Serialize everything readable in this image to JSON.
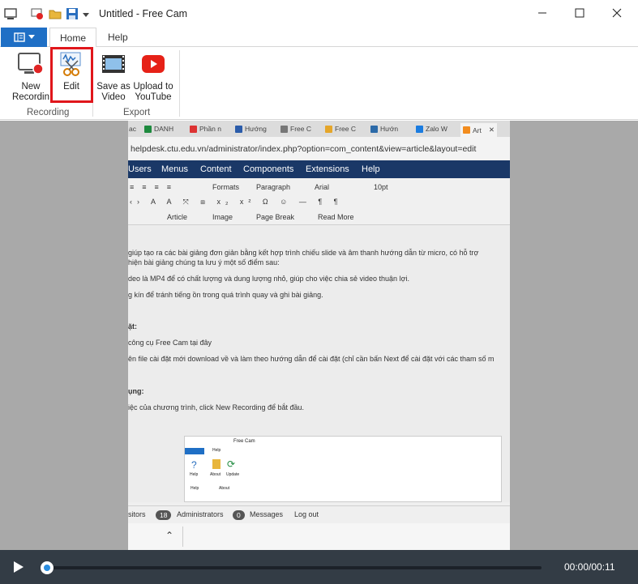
{
  "window": {
    "title": "Untitled - Free Cam"
  },
  "ribbon": {
    "tabs": [
      "Home",
      "Help"
    ],
    "buttons": {
      "new_recording": "New\nRecordin",
      "edit": "Edit",
      "save_as_video": "Save as\nVideo",
      "upload_youtube": "Upload to\nYouTube"
    },
    "groups": {
      "recording": "Recording",
      "export": "Export"
    }
  },
  "preview": {
    "browser_tabs": [
      "ac",
      "DANH",
      "Phần n",
      "Hướng",
      "Free C",
      "Free C",
      "Hướn",
      "Zalo W",
      "Art"
    ],
    "url": "helpdesk.ctu.edu.vn/administrator/index.php?option=com_content&view=article&layout=edit",
    "menu": [
      "Users",
      "Menus",
      "Content",
      "Components",
      "Extensions",
      "Help"
    ],
    "toolbar": {
      "formats": "Formats",
      "paragraph": "Paragraph",
      "font": "Arial",
      "size": "10pt",
      "article": "Article",
      "image": "Image",
      "page_break": "Page Break",
      "read_more": "Read More"
    },
    "content_lines": [
      "giúp tạo ra các bài giảng đơn giản bằng kết hợp trình chiếu slide và âm thanh hướng dẫn từ micro, có hỗ trợ",
      "hiện bài giảng chúng ta lưu ý một số điểm sau:",
      "deo là MP4 để có chất lượng và dung lượng nhỏ, giúp cho việc chia sẻ video thuận lợi.",
      "g kín để tránh tiếng ồn trong quá trình quay và ghi bài giảng.",
      "ặt:",
      "công cụ Free Cam tại đây",
      "ên file cài đặt mới download về và làm theo hướng dẫn để cài đặt (chỉ cần bấn Next để cài đặt với các tham số m",
      "ụng:",
      "iệc của chương trình, click New Recording để bắt đầu."
    ],
    "mini_app": {
      "title": "Free Cam",
      "tab": "Help",
      "buttons": [
        "Help",
        "About",
        "Update"
      ],
      "groups": [
        "Help",
        "About"
      ]
    },
    "status": {
      "visitors": "sitors",
      "admins_count": "18",
      "admins_label": "Administrators",
      "messages_count": "0",
      "messages_label": "Messages",
      "logout": "Log out"
    }
  },
  "player": {
    "time": "00:00/00:11",
    "progress": 0
  }
}
